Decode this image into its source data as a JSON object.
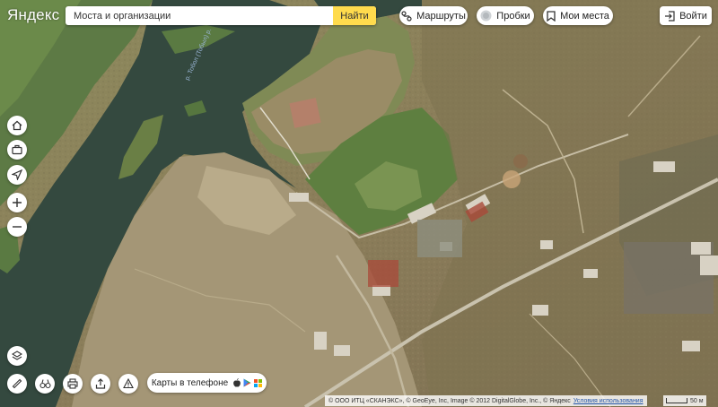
{
  "brand": {
    "logo_text": "Яндекс"
  },
  "search": {
    "placeholder": "Моста и организации",
    "button_label": "Найти"
  },
  "top_buttons": {
    "routes": "Маршруты",
    "traffic": "Пробки",
    "my_places": "Мои места",
    "login": "Войти"
  },
  "map": {
    "river_label": "р. Тобол (Тобыл) р.",
    "layer": "satellite"
  },
  "controls_left": [
    "home-icon",
    "briefcase-icon",
    "location-arrow-icon",
    "zoom-in-icon",
    "zoom-out-icon"
  ],
  "bottom_toolbar": {
    "phone_promo": "Карты в телефоне",
    "store_icons": [
      "apple-icon",
      "google-play-icon",
      "windows-icon"
    ]
  },
  "copyright": {
    "text": "© ООО ИТЦ «СКАНЭКС», © GeoEye, Inc, Image © 2012 DigitalGlobe, Inc., © Яндекс",
    "terms_link": "Условия использования"
  },
  "scale": {
    "label": "50 м"
  },
  "colors": {
    "accent_yellow": "#ffdb4d",
    "water": "#344a45",
    "terrain": "#8a7a5e"
  }
}
